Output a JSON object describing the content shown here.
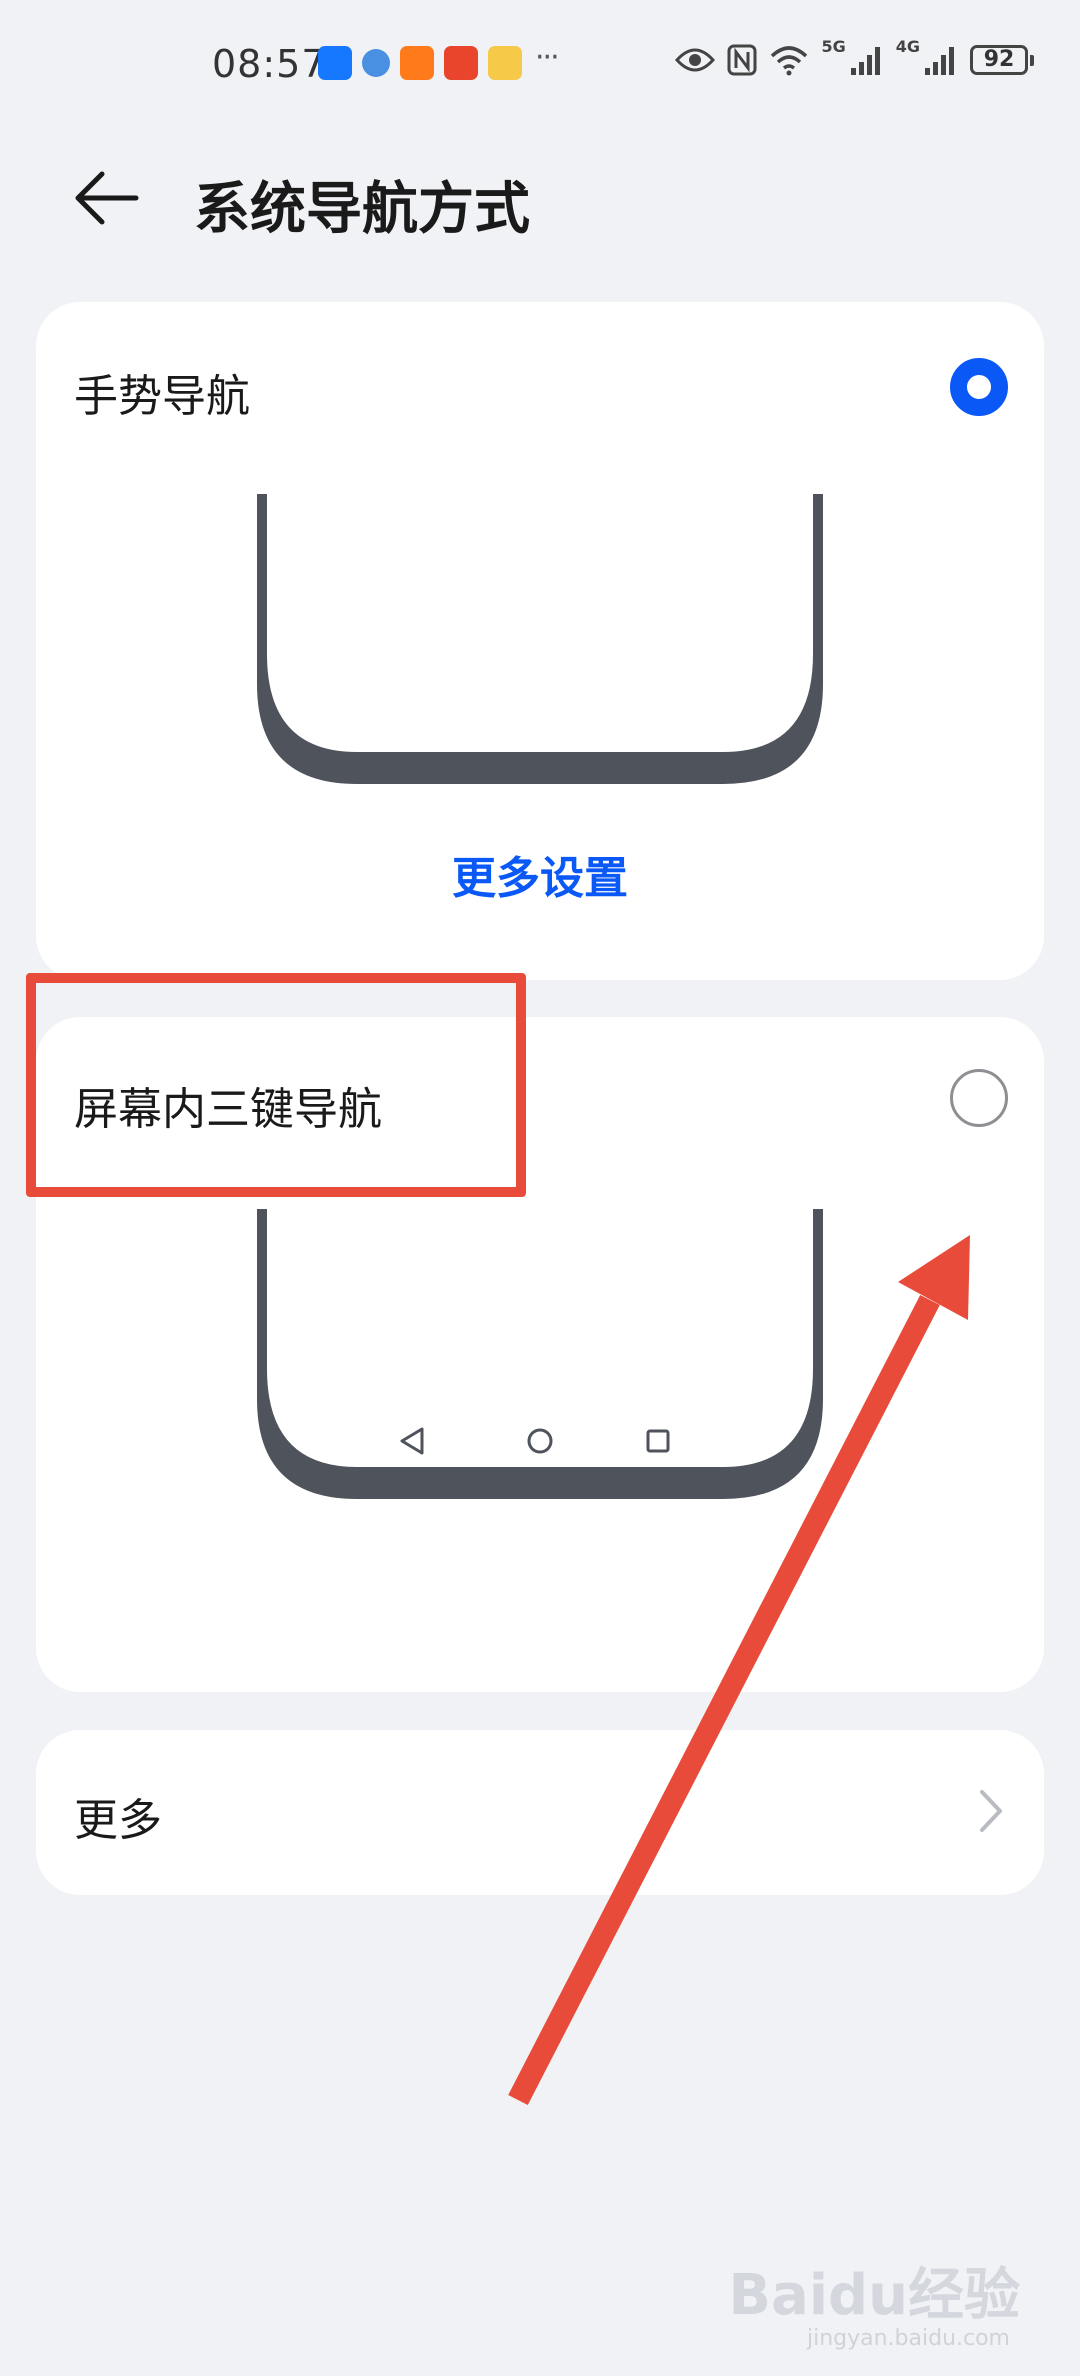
{
  "status_bar": {
    "time": "08:57",
    "network_1": "5G",
    "network_2": "4G",
    "battery": "92",
    "more_notifications": "···"
  },
  "header": {
    "title": "系统导航方式",
    "back_icon": "arrow-left-icon"
  },
  "options": [
    {
      "label": "手势导航",
      "selected": true,
      "link": "更多设置"
    },
    {
      "label": "屏幕内三键导航",
      "selected": false
    }
  ],
  "more_row": {
    "label": "更多"
  },
  "colors": {
    "accent": "#0a59f7",
    "background": "#f1f2f5",
    "annotation": "#e84b3a"
  },
  "watermark": {
    "text": "Baidu经验",
    "sub": "jingyan.baidu.com"
  }
}
